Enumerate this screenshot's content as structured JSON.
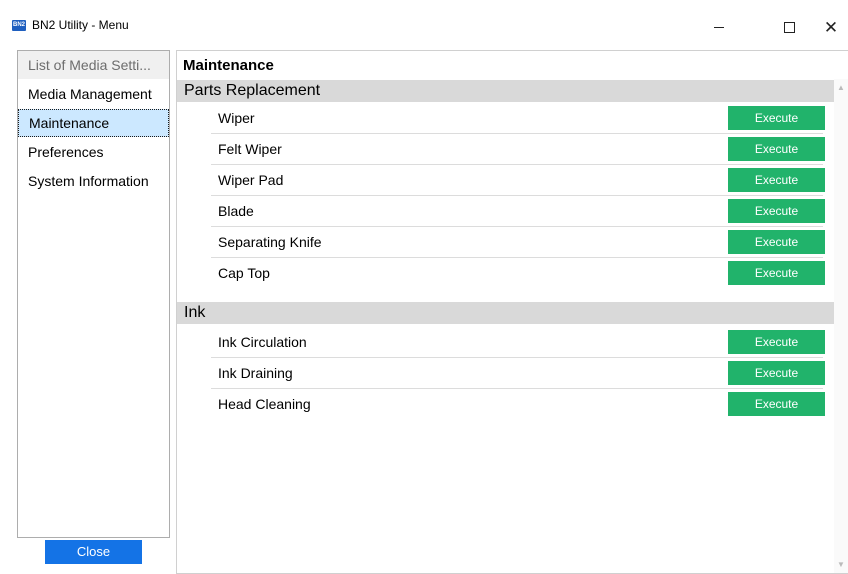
{
  "window": {
    "app_icon_text": "BN2",
    "title": "BN2 Utility - Menu",
    "minimize_glyph": "—",
    "maximize_glyph": "☐",
    "close_glyph": "✕"
  },
  "sidebar": {
    "items": [
      {
        "label": "List of Media Setti...",
        "state": "header"
      },
      {
        "label": "Media Management",
        "state": "normal"
      },
      {
        "label": "Maintenance",
        "state": "selected"
      },
      {
        "label": "Preferences",
        "state": "normal"
      },
      {
        "label": "System Information",
        "state": "normal"
      }
    ],
    "close_label": "Close"
  },
  "main": {
    "title": "Maintenance",
    "sections": [
      {
        "header": "Parts Replacement",
        "rows": [
          {
            "label": "Wiper",
            "button": "Execute"
          },
          {
            "label": "Felt Wiper",
            "button": "Execute"
          },
          {
            "label": "Wiper Pad",
            "button": "Execute"
          },
          {
            "label": "Blade",
            "button": "Execute"
          },
          {
            "label": "Separating Knife",
            "button": "Execute"
          },
          {
            "label": "Cap Top",
            "button": "Execute"
          }
        ]
      },
      {
        "header": "Ink",
        "rows": [
          {
            "label": "Ink Circulation",
            "button": "Execute"
          },
          {
            "label": "Ink Draining",
            "button": "Execute"
          },
          {
            "label": "Head Cleaning",
            "button": "Execute"
          }
        ]
      }
    ]
  },
  "colors": {
    "execute_button": "#21b36b",
    "close_button": "#1473e6",
    "selected_item": "#cce8ff",
    "section_header": "#d9d9d9"
  },
  "icons": {
    "app": "bn2-app-icon",
    "scroll_up": "chevron-up-icon",
    "scroll_down": "chevron-down-icon"
  }
}
